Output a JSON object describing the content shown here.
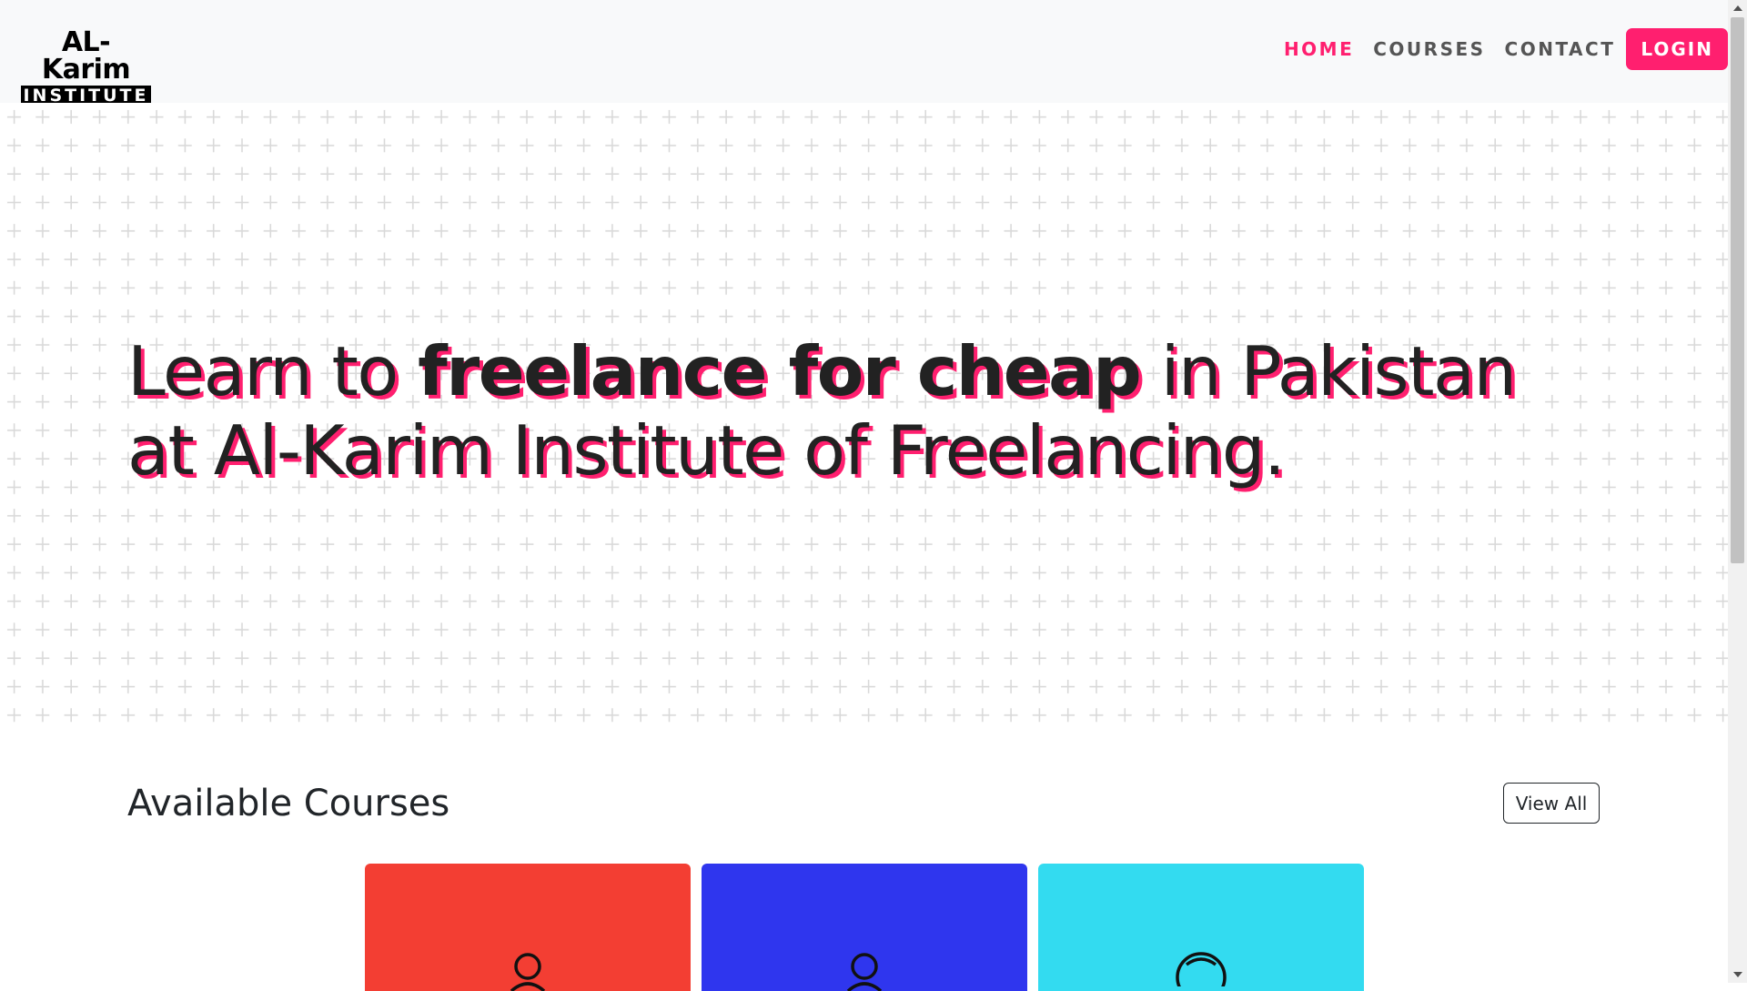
{
  "brand": {
    "line1": "AL-Karim",
    "line2": "INSTITUTE"
  },
  "nav": {
    "items": [
      {
        "label": "HOME",
        "active": true
      },
      {
        "label": "COURSES",
        "active": false
      },
      {
        "label": "CONTACT",
        "active": false
      }
    ],
    "login_label": "LOGIN"
  },
  "hero": {
    "title_before": "Learn to ",
    "title_bold": "freelance for cheap",
    "title_after": " in Pakistan at Al-Karim Institute of Freelancing."
  },
  "courses": {
    "section_title": "Available Courses",
    "view_all_label": "View All",
    "cards": [
      {
        "color": "#f33e33",
        "icon": "user-icon"
      },
      {
        "color": "#2f36ee",
        "icon": "user-icon"
      },
      {
        "color": "#33dbf0",
        "icon": "globe-icon"
      }
    ]
  },
  "colors": {
    "accent": "#ff1f6f",
    "navbar_bg": "#f8f9fa",
    "text": "#222222"
  }
}
